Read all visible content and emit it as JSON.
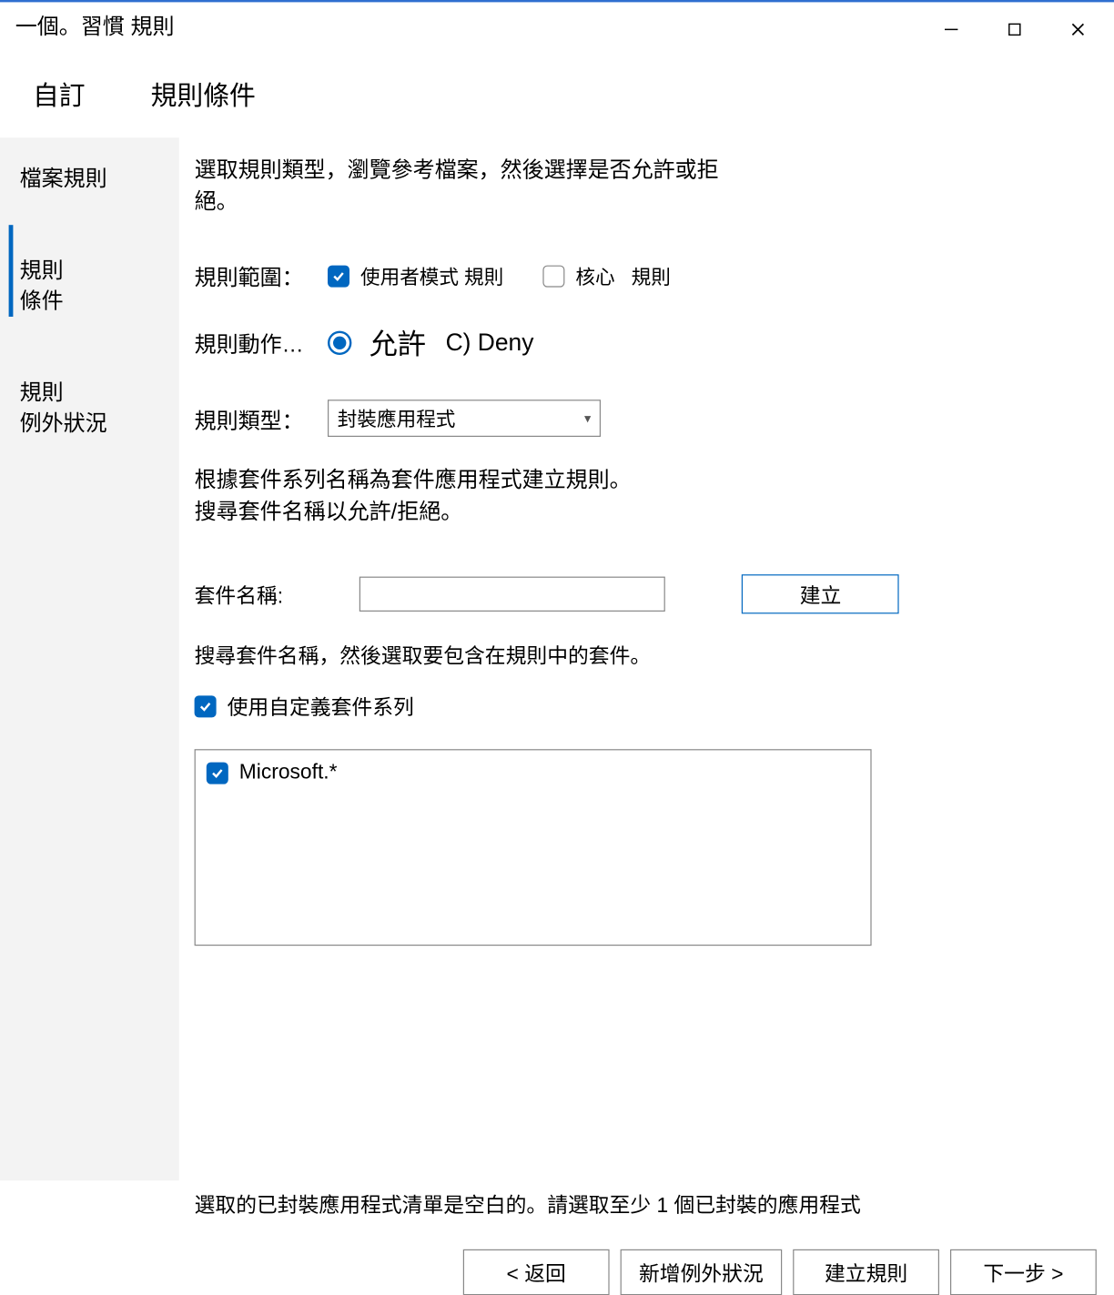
{
  "window": {
    "title": "一個。習慣 規則"
  },
  "subheader": {
    "left": "自訂",
    "right": "規則條件"
  },
  "sidebar": {
    "items": [
      {
        "label": "檔案規則"
      },
      {
        "label": "規則\n條件"
      },
      {
        "label": "規則\n例外狀況"
      }
    ]
  },
  "pane": {
    "intro": "選取規則類型，瀏覽參考檔案，然後選擇是否允許或拒絕。",
    "scope_label": "規則範圍：",
    "scope_user_mode": "使用者模式 規則",
    "scope_kernel": "核心   規則",
    "action_label": "規則動作…",
    "allow": "允許",
    "deny": "C) Deny",
    "type_label": "規則類型：",
    "type_value": "封裝應用程式",
    "desc_line1": "根據套件系列名稱為套件應用程式建立規則。",
    "desc_line2": "搜尋套件名稱以允許/拒絕。",
    "pkg_label": "套件名稱:",
    "create_btn": "建立",
    "search_hint": "搜尋套件名稱，然後選取要包含在規則中的套件。",
    "custom_pkg": "使用自定義套件系列",
    "list": [
      "Microsoft.*"
    ]
  },
  "footer": {
    "msg": "選取的已封裝應用程式清單是空白的。請選取至少 1 個已封裝的應用程式",
    "back": "< 返回",
    "add_exception": "新增例外狀況",
    "create_rule": "建立規則",
    "next": "下一步 >"
  }
}
